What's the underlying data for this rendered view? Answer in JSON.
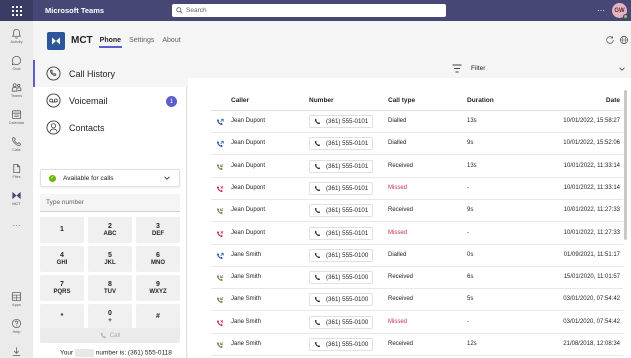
{
  "titlebar": {
    "app_title": "Microsoft Teams",
    "search_placeholder": "Search",
    "more": "···",
    "avatar_initials": "GW"
  },
  "rail": {
    "items": [
      {
        "label": "Activity",
        "icon": "bell-icon"
      },
      {
        "label": "Chat",
        "icon": "chat-icon"
      },
      {
        "label": "Teams",
        "icon": "teams-icon"
      },
      {
        "label": "Calendar",
        "icon": "calendar-icon"
      },
      {
        "label": "Calls",
        "icon": "phone-icon"
      },
      {
        "label": "Files",
        "icon": "file-icon"
      },
      {
        "label": "MCT",
        "icon": "mct-icon"
      },
      {
        "label": "···",
        "icon": "more-icon"
      },
      {
        "label": "Apps",
        "icon": "apps-icon"
      },
      {
        "label": "Help",
        "icon": "help-icon"
      }
    ]
  },
  "app_header": {
    "name": "MCT",
    "tabs": [
      "Phone",
      "Settings",
      "About"
    ]
  },
  "left_nav": {
    "items": [
      {
        "label": "Call History",
        "icon": "phone-circle-icon"
      },
      {
        "label": "Voicemail",
        "icon": "voicemail-icon",
        "badge": "1"
      },
      {
        "label": "Contacts",
        "icon": "contact-icon"
      }
    ]
  },
  "status": {
    "label": "Available for calls",
    "color": "#6bb700"
  },
  "dialer": {
    "placeholder": "Type number",
    "keys": [
      {
        "digit": "1",
        "letters": ""
      },
      {
        "digit": "2",
        "letters": "ABC"
      },
      {
        "digit": "3",
        "letters": "DEF"
      },
      {
        "digit": "4",
        "letters": "GHI"
      },
      {
        "digit": "5",
        "letters": "JKL"
      },
      {
        "digit": "6",
        "letters": "MNO"
      },
      {
        "digit": "7",
        "letters": "PQRS"
      },
      {
        "digit": "8",
        "letters": "TUV"
      },
      {
        "digit": "9",
        "letters": "WXYZ"
      },
      {
        "digit": "*",
        "letters": ""
      },
      {
        "digit": "0",
        "letters": "+"
      },
      {
        "digit": "#",
        "letters": ""
      }
    ],
    "call_label": "Call",
    "your_number_prefix": "Your",
    "your_number_suffix": "number is: (361) 555-0118"
  },
  "filter": {
    "label": "Filter"
  },
  "table": {
    "headers": {
      "caller": "Caller",
      "number": "Number",
      "type": "Call type",
      "duration": "Duration",
      "date": "Date"
    },
    "rows": [
      {
        "caller": "Jean Dupont",
        "number": "(361) 555-0101",
        "type": "Dialled",
        "kind": "dialled",
        "duration": "13s",
        "date": "10/01/2022, 15:58:27"
      },
      {
        "caller": "Jean Dupont",
        "number": "(361) 555-0101",
        "type": "Dialled",
        "kind": "dialled",
        "duration": "9s",
        "date": "10/01/2022, 15:52:06"
      },
      {
        "caller": "Jean Dupont",
        "number": "(361) 555-0101",
        "type": "Received",
        "kind": "received",
        "duration": "13s",
        "date": "10/01/2022, 11:33:14"
      },
      {
        "caller": "Jean Dupont",
        "number": "(361) 555-0101",
        "type": "Missed",
        "kind": "missed",
        "duration": "-",
        "date": "10/01/2022, 11:33:14"
      },
      {
        "caller": "Jean Dupont",
        "number": "(361) 555-0101",
        "type": "Received",
        "kind": "received",
        "duration": "9s",
        "date": "10/01/2022, 11:27:33"
      },
      {
        "caller": "Jean Dupont",
        "number": "(361) 555-0101",
        "type": "Missed",
        "kind": "missed",
        "duration": "-",
        "date": "10/01/2022, 11:27:33"
      },
      {
        "caller": "Jane Smith",
        "number": "(361) 555-0100",
        "type": "Dialled",
        "kind": "dialled",
        "duration": "0s",
        "date": "01/09/2021, 11:51:17"
      },
      {
        "caller": "Jane Smith",
        "number": "(361) 555-0100",
        "type": "Received",
        "kind": "received",
        "duration": "6s",
        "date": "15/01/2020, 11:01:57"
      },
      {
        "caller": "Jane Smith",
        "number": "(361) 555-0100",
        "type": "Received",
        "kind": "received",
        "duration": "5s",
        "date": "03/01/2020, 07:54:42"
      },
      {
        "caller": "Jane Smith",
        "number": "(361) 555-0100",
        "type": "Missed",
        "kind": "missed",
        "duration": "-",
        "date": "03/01/2020, 07:54:42"
      },
      {
        "caller": "Jane Smith",
        "number": "(361) 555-0100",
        "type": "Received",
        "kind": "received",
        "duration": "12s",
        "date": "21/08/2018, 12:08:34"
      }
    ]
  },
  "colors": {
    "titlebar": "#464775",
    "accent": "#5b5fc7",
    "dialled": "#2b579a",
    "received": "#6a8a4a",
    "missed": "#c4314b"
  }
}
